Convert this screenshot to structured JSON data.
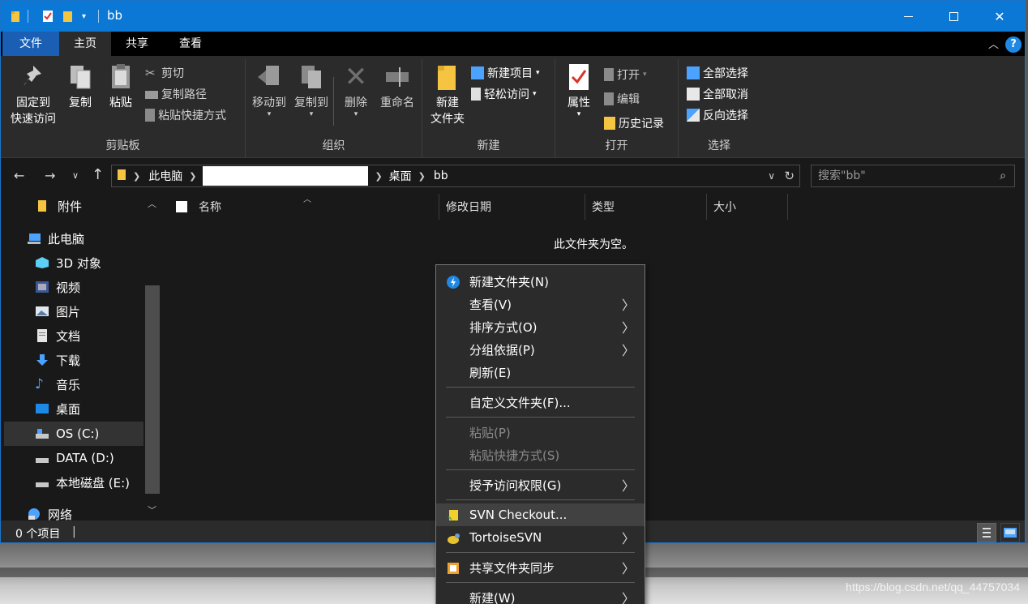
{
  "window": {
    "title": "bb"
  },
  "ribbon_tabs": [
    {
      "label": "文件"
    },
    {
      "label": "主页"
    },
    {
      "label": "共享"
    },
    {
      "label": "查看"
    }
  ],
  "ribbon": {
    "clipboard": {
      "group_label": "剪贴板",
      "pin_line1": "固定到",
      "pin_line2": "快速访问",
      "copy": "复制",
      "paste": "粘贴",
      "cut": "剪切",
      "copy_path": "复制路径",
      "paste_shortcut": "粘贴快捷方式"
    },
    "organize": {
      "group_label": "组织",
      "move_to": "移动到",
      "copy_to": "复制到",
      "delete": "删除",
      "rename": "重命名"
    },
    "new": {
      "group_label": "新建",
      "new_folder_line1": "新建",
      "new_folder_line2": "文件夹",
      "new_item": "新建项目",
      "easy_access": "轻松访问"
    },
    "open": {
      "group_label": "打开",
      "properties": "属性",
      "open": "打开",
      "edit": "编辑",
      "history": "历史记录"
    },
    "select": {
      "group_label": "选择",
      "select_all": "全部选择",
      "select_none": "全部取消",
      "invert": "反向选择"
    }
  },
  "address": {
    "crumbs": [
      "此电脑",
      "桌面",
      "bb"
    ]
  },
  "search": {
    "placeholder": "搜索\"bb\""
  },
  "nav_pane": [
    {
      "label": "附件",
      "icon": "folder-icon"
    },
    {
      "label": "此电脑",
      "icon": "computer-icon"
    },
    {
      "label": "3D 对象",
      "icon": "cube-icon"
    },
    {
      "label": "视频",
      "icon": "video-icon"
    },
    {
      "label": "图片",
      "icon": "picture-icon"
    },
    {
      "label": "文档",
      "icon": "document-icon"
    },
    {
      "label": "下载",
      "icon": "download-icon"
    },
    {
      "label": "音乐",
      "icon": "music-icon"
    },
    {
      "label": "桌面",
      "icon": "desktop-icon"
    },
    {
      "label": "OS (C:)",
      "icon": "drive-icon"
    },
    {
      "label": "DATA (D:)",
      "icon": "drive-icon"
    },
    {
      "label": "本地磁盘 (E:)",
      "icon": "drive-icon"
    },
    {
      "label": "网络",
      "icon": "network-icon"
    }
  ],
  "columns": [
    {
      "label": "名称"
    },
    {
      "label": "修改日期"
    },
    {
      "label": "类型"
    },
    {
      "label": "大小"
    }
  ],
  "empty_message": "此文件夹为空。",
  "status": {
    "item_count": "0 个项目"
  },
  "context_menu": [
    {
      "label": "新建文件夹(N)"
    },
    {
      "label": "查看(V)"
    },
    {
      "label": "排序方式(O)"
    },
    {
      "label": "分组依据(P)"
    },
    {
      "label": "刷新(E)"
    },
    {
      "label": "自定义文件夹(F)..."
    },
    {
      "label": "粘贴(P)"
    },
    {
      "label": "粘贴快捷方式(S)"
    },
    {
      "label": "授予访问权限(G)"
    },
    {
      "label": "SVN Checkout..."
    },
    {
      "label": "TortoiseSVN"
    },
    {
      "label": "共享文件夹同步"
    },
    {
      "label": "新建(W)"
    }
  ],
  "watermark": "https://blog.csdn.net/qq_44757034"
}
